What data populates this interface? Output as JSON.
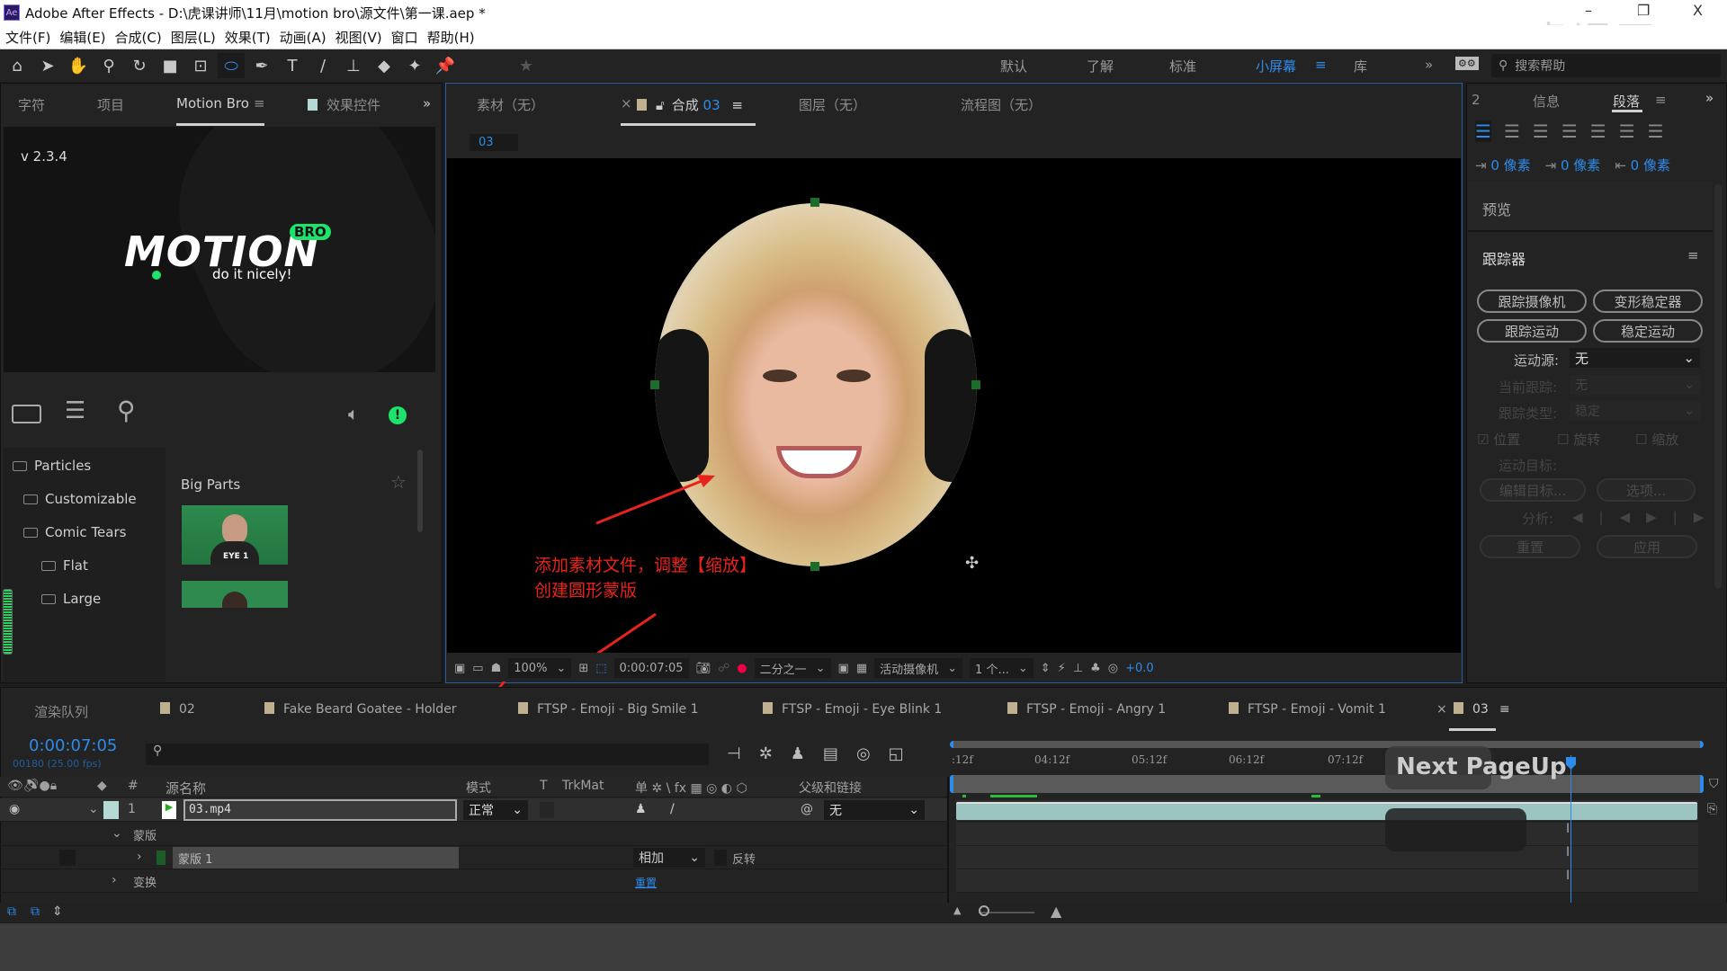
{
  "window": {
    "title": "Adobe After Effects - D:\\虎课讲师\\11月\\motion bro\\源文件\\第一课.aep *",
    "app_icon": "Ae",
    "min": "–",
    "max": "❐",
    "close": "X",
    "watermark": "虎课网"
  },
  "menu": [
    "文件(F)",
    "编辑(E)",
    "合成(C)",
    "图层(L)",
    "效果(T)",
    "动画(A)",
    "视图(V)",
    "窗口",
    "帮助(H)"
  ],
  "toolbar": {
    "icons": [
      "home-icon",
      "selection-arrow-icon",
      "hand-icon",
      "zoom-icon",
      "rotate-icon",
      "camera-icon",
      "pan-behind-icon",
      "ellipse-icon",
      "pen-icon",
      "text-icon",
      "brush-icon",
      "clone-stamp-icon",
      "eraser-icon",
      "roto-brush-icon",
      "puppet-pin-icon"
    ],
    "workspaces": [
      "默认",
      "了解",
      "标准",
      "小屏幕",
      "库"
    ],
    "active_workspace": "小屏幕",
    "search_placeholder": "搜索帮助"
  },
  "left_panel": {
    "tabs": [
      "字符",
      "项目",
      "Motion Bro",
      "效果控件"
    ],
    "active_tab": "Motion Bro",
    "version": "v 2.3.4",
    "logo_text": "MOTION",
    "logo_badge": "BRO",
    "tagline": "do it nicely!",
    "tree": [
      "Particles",
      "Customizable",
      "Comic Tears",
      "Flat",
      "Large"
    ],
    "category_title": "Big Parts",
    "thumb_label": "EYE 1"
  },
  "viewer": {
    "tabs": [
      "素材（无）",
      "合成 03",
      "图层（无）",
      "流程图（无）"
    ],
    "active_tab": "合成 03",
    "comp_name_prefix": "合成",
    "comp_name": "03",
    "comp_chip": "03",
    "annotation_line1": "添加素材文件，调整【缩放】",
    "annotation_line2": "创建圆形蒙版",
    "zoom": "100%",
    "timecode": "0:00:07:05",
    "resolution": "二分之一",
    "camera": "活动摄像机",
    "views": "1 个...",
    "exposure": "+0.0"
  },
  "right_panel": {
    "tabs": [
      "2",
      "信息",
      "段落"
    ],
    "active_tab": "段落",
    "indent_values": [
      "0 像素",
      "0 像素",
      "0 像素"
    ],
    "preview_label": "预览",
    "tracker_title": "跟踪器",
    "buttons": [
      "跟踪摄像机",
      "变形稳定器",
      "跟踪运动",
      "稳定运动"
    ],
    "motion_source_label": "运动源:",
    "motion_source_value": "无",
    "current_track_label": "当前跟踪:",
    "current_track_value": "无",
    "track_type_label": "跟踪类型:",
    "track_type_value": "稳定",
    "checks": [
      {
        "label": "位置",
        "checked": true
      },
      {
        "label": "旋转",
        "checked": false
      },
      {
        "label": "缩放",
        "checked": false
      }
    ],
    "motion_target_label": "运动目标:",
    "edit_target": "编辑目标...",
    "options": "选项...",
    "analyze_label": "分析:",
    "reset": "重置",
    "apply": "应用"
  },
  "timeline": {
    "tabs": [
      "渲染队列",
      "02",
      "Fake Beard Goatee - Holder",
      "FTSP - Emoji - Big Smile 1",
      "FTSP - Emoji - Eye Blink 1",
      "FTSP - Emoji - Angry 1",
      "FTSP - Emoji - Vomit 1",
      "03"
    ],
    "active_tab": "03",
    "timecode": "0:00:07:05",
    "frame_info": "00180 (25.00 fps)",
    "columns": {
      "hash": "#",
      "source": "源名称",
      "mode": "模式",
      "t": "T",
      "trkmat": "TrkMat",
      "switches": "单 ✲ \\ fx ▦ ◎ ◐ ⬡",
      "parent": "父级和链接"
    },
    "layer": {
      "index": "1",
      "name": "03.mp4",
      "mode": "正常",
      "parent": "无"
    },
    "masks_group": "蒙版",
    "mask": {
      "name": "蒙版 1",
      "mode": "相加",
      "invert": "反转"
    },
    "transform": "变换",
    "reset": "重置",
    "ruler": [
      ":12f",
      "04:12f",
      "05:12f",
      "06:12f",
      "07:12f"
    ],
    "overlay_key": "Next  PageUp",
    "playhead_time": "0:00:07:05"
  },
  "colors": {
    "accent": "#2d8ceb",
    "annotation": "#e8231c",
    "motion_green": "#1ee36b",
    "layer_bar": "#9cc4c0"
  }
}
